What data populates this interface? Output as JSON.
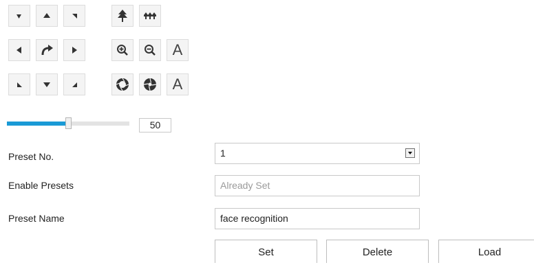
{
  "ptz": {
    "rows": [
      [
        "up-left-icon",
        "up-icon",
        "up-right-icon",
        "focus-near-icon",
        "focus-far-icon"
      ],
      [
        "left-icon",
        "auto-rotate-icon",
        "right-icon",
        "zoom-in-icon",
        "zoom-out-icon",
        "letter-a-icon"
      ],
      [
        "down-left-icon",
        "down-icon",
        "down-right-icon",
        "iris-open-icon",
        "iris-close-icon",
        "letter-a-icon"
      ]
    ],
    "letter_a": "A",
    "speed": {
      "value": "50",
      "level": 50,
      "max": 100
    }
  },
  "preset": {
    "number_label": "Preset No.",
    "number_value": "1",
    "enable_label": "Enable Presets",
    "enable_value": "Already Set",
    "name_label": "Preset Name",
    "name_value": "face recognition"
  },
  "buttons": {
    "set": "Set",
    "delete": "Delete",
    "load": "Load"
  },
  "colors": {
    "slider_fill": "#1a9ad6",
    "icon": "#333333"
  }
}
